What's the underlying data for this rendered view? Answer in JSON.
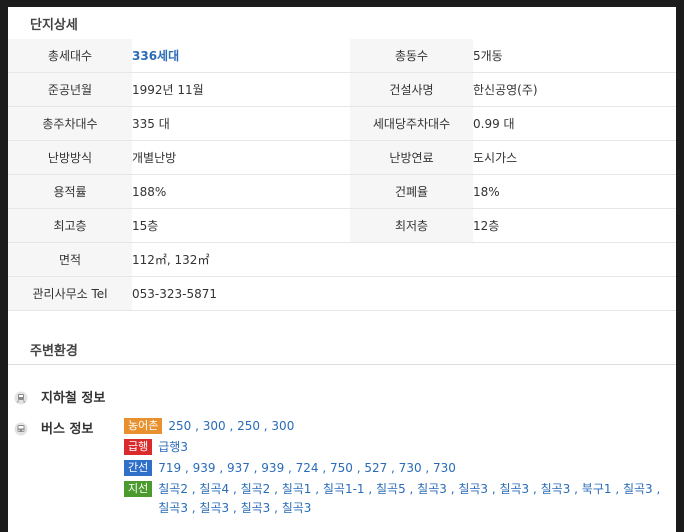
{
  "detail": {
    "title": "단지상세",
    "rows": [
      {
        "l1": "총세대수",
        "v1": "336세대",
        "l2": "총동수",
        "v2": "5개동"
      },
      {
        "l1": "준공년월",
        "v1": "1992년 11월",
        "l2": "건설사명",
        "v2": "한신공영(주)"
      },
      {
        "l1": "총주차대수",
        "v1": "335 대",
        "l2": "세대당주차대수",
        "v2": "0.99 대"
      },
      {
        "l1": "난방방식",
        "v1": "개별난방",
        "l2": "난방연료",
        "v2": "도시가스"
      },
      {
        "l1": "용적률",
        "v1": "188%",
        "l2": "건폐율",
        "v2": "18%"
      },
      {
        "l1": "최고층",
        "v1": "15층",
        "l2": "최저층",
        "v2": "12층"
      },
      {
        "l1": "면적",
        "v1": "112㎡, 132㎡"
      },
      {
        "l1": "관리사무소 Tel",
        "v1": "053-323-5871"
      }
    ]
  },
  "environment": {
    "title": "주변환경",
    "subway": {
      "label": "지하철 정보",
      "icon": "subway-icon"
    },
    "bus": {
      "label": "버스 정보",
      "icon": "bus-icon",
      "lines": [
        {
          "badge": "농어촌",
          "color": "#e8902e",
          "routes": "250 , 300 , 250 , 300"
        },
        {
          "badge": "급행",
          "color": "#d92b2b",
          "routes": "급행3"
        },
        {
          "badge": "간선",
          "color": "#2f6fc9",
          "routes": "719 , 939 , 937 , 939 , 724 , 750 , 527 , 730 , 730"
        },
        {
          "badge": "지선",
          "color": "#4b9a2e",
          "routes": "칠곡2 , 칠곡4 , 칠곡2 , 칠곡1 , 칠곡1-1 , 칠곡5 , 칠곡3 , 칠곡3 , 칠곡3 , 칠곡3 , 북구1 , 칠곡3 , 칠곡3 , 칠곡3 , 칠곡3 , 칠곡3"
        }
      ]
    }
  }
}
